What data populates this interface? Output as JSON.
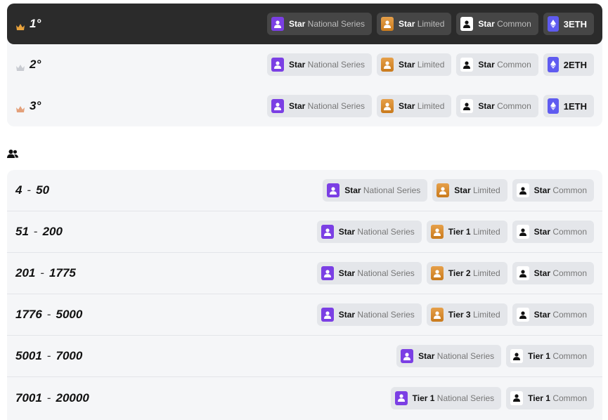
{
  "podium": [
    {
      "rank": "1°",
      "crown_color": "#e8a23c",
      "rewards": [
        {
          "icon": "purple",
          "bold": "Star",
          "rest": " National Series"
        },
        {
          "icon": "orange",
          "bold": "Star",
          "rest": " Limited"
        },
        {
          "icon": "white",
          "bold": "Star",
          "rest": " Common"
        },
        {
          "icon": "eth",
          "bold": "3ETH",
          "rest": ""
        }
      ]
    },
    {
      "rank": "2°",
      "crown_color": "#c9ccd2",
      "rewards": [
        {
          "icon": "purple",
          "bold": "Star",
          "rest": " National Series"
        },
        {
          "icon": "orange",
          "bold": "Star",
          "rest": " Limited"
        },
        {
          "icon": "white",
          "bold": "Star",
          "rest": " Common"
        },
        {
          "icon": "eth",
          "bold": "2ETH",
          "rest": ""
        }
      ]
    },
    {
      "rank": "3°",
      "crown_color": "#e3a07a",
      "rewards": [
        {
          "icon": "purple",
          "bold": "Star",
          "rest": " National Series"
        },
        {
          "icon": "orange",
          "bold": "Star",
          "rest": " Limited"
        },
        {
          "icon": "white",
          "bold": "Star",
          "rest": " Common"
        },
        {
          "icon": "eth",
          "bold": "1ETH",
          "rest": ""
        }
      ]
    }
  ],
  "tiers": [
    {
      "from": "4",
      "to": "50",
      "rewards": [
        {
          "icon": "purple",
          "bold": "Star",
          "rest": " National Series"
        },
        {
          "icon": "orange",
          "bold": "Star",
          "rest": " Limited"
        },
        {
          "icon": "white",
          "bold": "Star",
          "rest": " Common"
        }
      ]
    },
    {
      "from": "51",
      "to": "200",
      "rewards": [
        {
          "icon": "purple",
          "bold": "Star",
          "rest": " National Series"
        },
        {
          "icon": "orange",
          "bold": "Tier 1",
          "rest": " Limited"
        },
        {
          "icon": "white",
          "bold": "Star",
          "rest": " Common"
        }
      ]
    },
    {
      "from": "201",
      "to": "1775",
      "rewards": [
        {
          "icon": "purple",
          "bold": "Star",
          "rest": " National Series"
        },
        {
          "icon": "orange",
          "bold": "Tier 2",
          "rest": " Limited"
        },
        {
          "icon": "white",
          "bold": "Star",
          "rest": " Common"
        }
      ]
    },
    {
      "from": "1776",
      "to": "5000",
      "rewards": [
        {
          "icon": "purple",
          "bold": "Star",
          "rest": " National Series"
        },
        {
          "icon": "orange",
          "bold": "Tier 3",
          "rest": " Limited"
        },
        {
          "icon": "white",
          "bold": "Star",
          "rest": " Common"
        }
      ]
    },
    {
      "from": "5001",
      "to": "7000",
      "rewards": [
        {
          "icon": "purple",
          "bold": "Star",
          "rest": " National Series"
        },
        {
          "icon": "white",
          "bold": "Tier 1",
          "rest": " Common"
        }
      ]
    },
    {
      "from": "7001",
      "to": "20000",
      "rewards": [
        {
          "icon": "purple",
          "bold": "Tier 1",
          "rest": " National Series"
        },
        {
          "icon": "white",
          "bold": "Tier 1",
          "rest": " Common"
        }
      ]
    }
  ],
  "icons": {
    "crown": "crown-icon",
    "people": "people-icon",
    "player": "player-icon",
    "eth": "ethereum-icon"
  }
}
